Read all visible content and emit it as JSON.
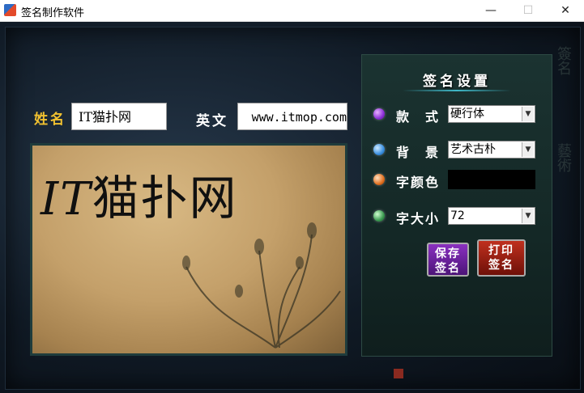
{
  "window": {
    "title": "签名制作软件",
    "min": "—",
    "max": "☐",
    "close": "✕"
  },
  "form": {
    "name_label": "姓名",
    "name_value": "IT猫扑网",
    "english_label": "英文",
    "english_value": "www.itmop.com"
  },
  "preview": {
    "prefix": "IT",
    "text": "猫扑网"
  },
  "settings": {
    "title": "签名设置",
    "style_label": "款　式",
    "style_value": "硬行体",
    "background_label": "背　景",
    "background_value": "艺术古朴",
    "color_label": "字颜色",
    "font_color": "#000000",
    "size_label": "字大小",
    "size_value": "72",
    "save_line1": "保存",
    "save_line2": "签名",
    "print_line1": "打印",
    "print_line2": "签名"
  },
  "colors": {
    "name_label": "#f2c230",
    "english_label": "#ffffff"
  }
}
